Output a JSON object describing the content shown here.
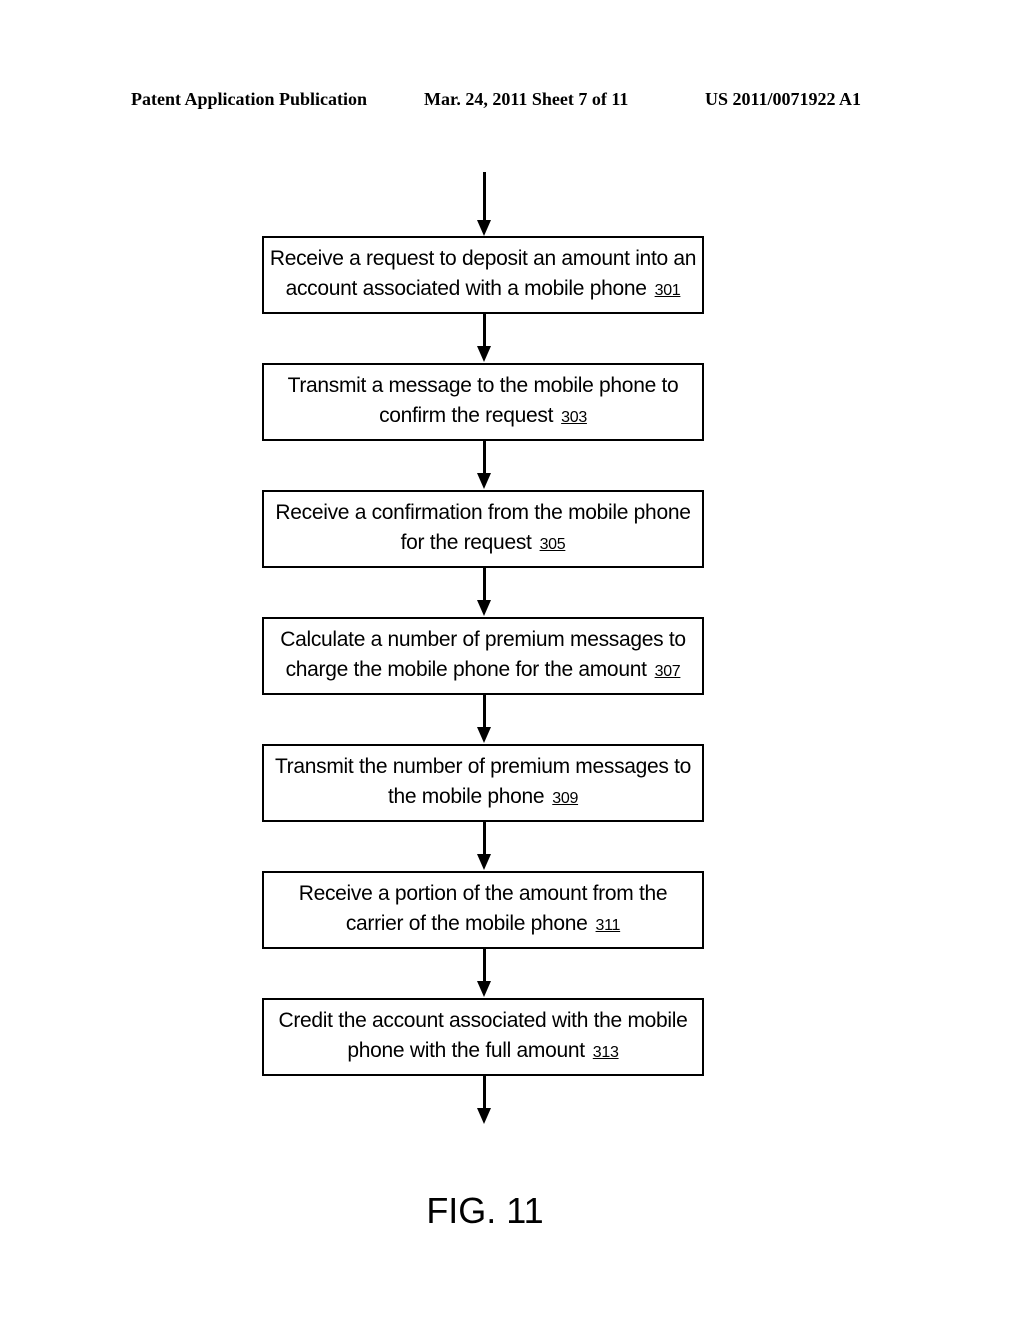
{
  "header": {
    "left": "Patent Application Publication",
    "middle": "Mar. 24, 2011  Sheet 7 of 11",
    "right": "US 2011/0071922 A1"
  },
  "steps": [
    {
      "text": "Receive a request to deposit an amount into an account associated with a mobile phone",
      "ref": "301"
    },
    {
      "text": "Transmit a message to the mobile phone to confirm the request",
      "ref": "303"
    },
    {
      "text": "Receive a confirmation from the mobile phone for the request",
      "ref": "305"
    },
    {
      "text": "Calculate a number of premium messages to charge the mobile phone for the amount",
      "ref": "307"
    },
    {
      "text": "Transmit the number of premium messages to the mobile phone",
      "ref": "309"
    },
    {
      "text": "Receive a portion of the amount from the carrier of the mobile phone",
      "ref": "311"
    },
    {
      "text": "Credit the account associated with the mobile phone with the full amount",
      "ref": "313"
    }
  ],
  "figure_label": "FIG. 11"
}
